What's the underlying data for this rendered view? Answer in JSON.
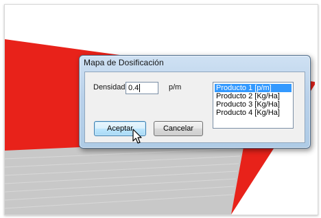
{
  "dialog": {
    "title": "Mapa de Dosificación",
    "density_label": "Densidad",
    "density_value": "0.4",
    "unit_label": "p/m",
    "products": [
      {
        "label": "Producto 1 [p/m]",
        "selected": true
      },
      {
        "label": "Producto 2 [Kg/Ha]",
        "selected": false
      },
      {
        "label": "Producto 3 [Kg/Ha]",
        "selected": false
      },
      {
        "label": "Producto 4 [Kg/Ha]",
        "selected": false
      }
    ],
    "accept_label": "Aceptar",
    "cancel_label": "Cancelar"
  },
  "colors": {
    "map_red": "#e8221a",
    "map_gray": "#c8c8c8",
    "selection": "#3399ff"
  },
  "icons": {
    "cursor": "arrow-pointer-icon"
  }
}
